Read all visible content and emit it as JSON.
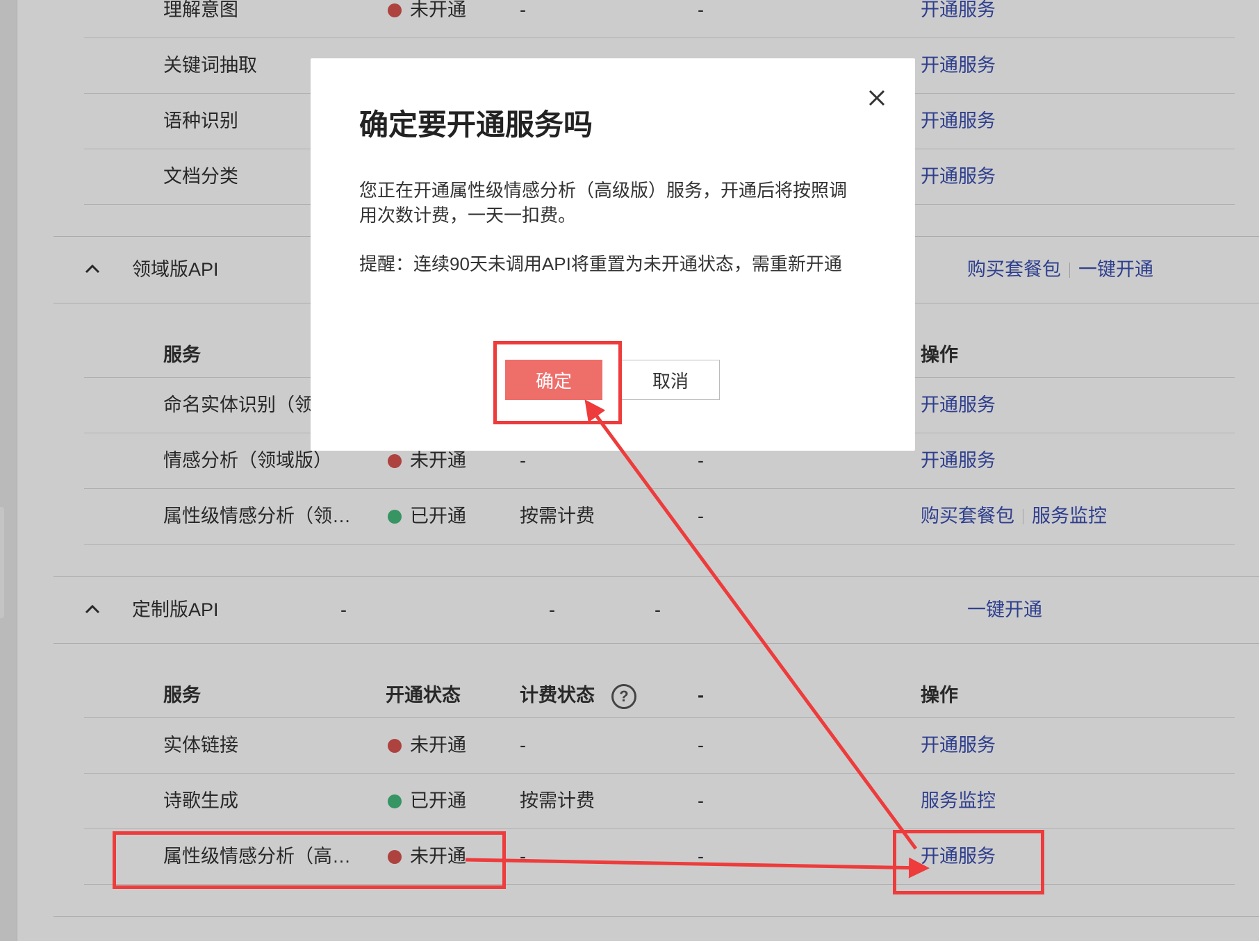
{
  "top_rows": [
    {
      "name": "理解意图",
      "status": "未开通",
      "status_color": "red",
      "billing": "-",
      "col4": "-",
      "op": "开通服务"
    },
    {
      "name": "关键词抽取",
      "op": "开通服务"
    },
    {
      "name": "语种识别",
      "op": "开通服务"
    },
    {
      "name": "文档分类",
      "op": "开通服务"
    }
  ],
  "domain_section": {
    "title": "领域版API",
    "actions": [
      "购买套餐包",
      "一键开通"
    ],
    "header": {
      "service": "服务",
      "op": "操作"
    },
    "rows": [
      {
        "name": "命名实体识别（领",
        "op": "开通服务"
      },
      {
        "name": "情感分析（领域版）",
        "status": "未开通",
        "status_color": "red",
        "billing": "-",
        "col4": "-",
        "op": "开通服务"
      },
      {
        "name": "属性级情感分析（领…",
        "status": "已开通",
        "status_color": "green",
        "billing": "按需计费",
        "col4": "-",
        "op_links": [
          "购买套餐包",
          "服务监控"
        ]
      }
    ]
  },
  "custom_section": {
    "title": "定制版API",
    "col2": "-",
    "col3": "-",
    "col4": "-",
    "action": "一键开通",
    "header": {
      "service": "服务",
      "status": "开通状态",
      "billing": "计费状态",
      "col4": "-",
      "op": "操作",
      "help": "?"
    },
    "rows": [
      {
        "name": "实体链接",
        "status": "未开通",
        "status_color": "red",
        "billing": "-",
        "col4": "-",
        "op": "开通服务"
      },
      {
        "name": "诗歌生成",
        "status": "已开通",
        "status_color": "green",
        "billing": "按需计费",
        "col4": "-",
        "op": "服务监控"
      },
      {
        "name": "属性级情感分析（高…",
        "status": "未开通",
        "status_color": "red",
        "billing": "-",
        "col4": "-",
        "op": "开通服务"
      }
    ]
  },
  "modal": {
    "title": "确定要开通服务吗",
    "body": "您正在开通属性级情感分析（高级版）服务，开通后将按照调用次数计费，一天一扣费。",
    "reminder": "提醒：连续90天未调用API将重置为未开通状态，需重新开通",
    "ok_label": "确定",
    "cancel_label": "取消"
  },
  "colors": {
    "link": "#3b4fb2",
    "status_red": "#d9534f",
    "status_green": "#45b97c",
    "confirm": "#ee6e6a",
    "annotation": "#ee3b3b"
  }
}
